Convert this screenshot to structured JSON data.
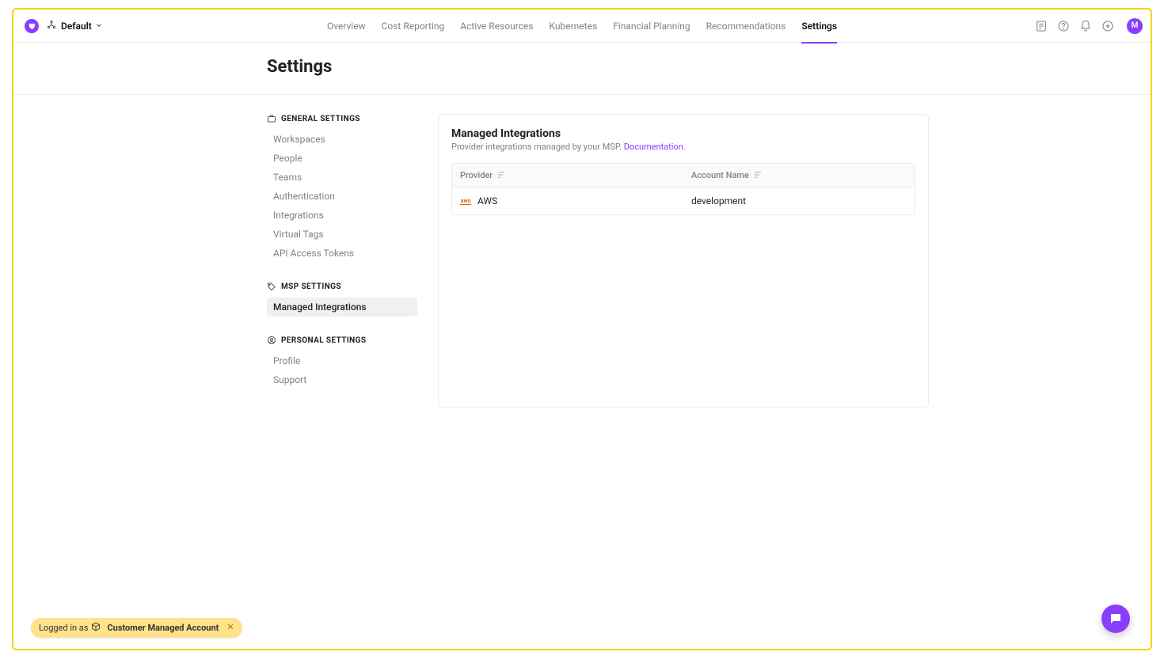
{
  "header": {
    "workspace_label": "Default",
    "nav": [
      {
        "label": "Overview"
      },
      {
        "label": "Cost Reporting"
      },
      {
        "label": "Active Resources"
      },
      {
        "label": "Kubernetes"
      },
      {
        "label": "Financial Planning"
      },
      {
        "label": "Recommendations"
      },
      {
        "label": "Settings",
        "active": true
      }
    ],
    "avatar_initial": "M"
  },
  "page": {
    "title": "Settings"
  },
  "sidebar": {
    "sections": [
      {
        "heading": "GENERAL SETTINGS",
        "icon": "briefcase-icon",
        "items": [
          {
            "label": "Workspaces"
          },
          {
            "label": "People"
          },
          {
            "label": "Teams"
          },
          {
            "label": "Authentication"
          },
          {
            "label": "Integrations"
          },
          {
            "label": "Virtual Tags"
          },
          {
            "label": "API Access Tokens"
          }
        ]
      },
      {
        "heading": "MSP SETTINGS",
        "icon": "tag-icon",
        "items": [
          {
            "label": "Managed Integrations",
            "active": true
          }
        ]
      },
      {
        "heading": "PERSONAL SETTINGS",
        "icon": "user-circle-icon",
        "items": [
          {
            "label": "Profile"
          },
          {
            "label": "Support"
          }
        ]
      }
    ]
  },
  "panel": {
    "title": "Managed Integrations",
    "subtitle_prefix": "Provider integrations managed by your MSP. ",
    "doc_link_label": "Documentation.",
    "columns": [
      {
        "label": "Provider"
      },
      {
        "label": "Account Name"
      }
    ],
    "rows": [
      {
        "provider": "AWS",
        "account": "development"
      }
    ]
  },
  "footer_pill": {
    "prefix": "Logged in as",
    "strong": "Customer Managed Account"
  }
}
